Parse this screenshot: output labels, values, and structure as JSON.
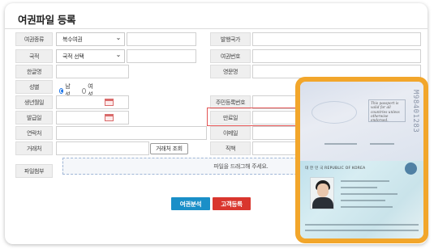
{
  "title": "여권파일 등록",
  "form": {
    "passport_type_label": "여권종류",
    "passport_type_value": "복수여권",
    "issuing_country_label": "발행국가",
    "nationality_label": "국적",
    "nationality_value": "국적 선택",
    "passport_no_label": "여권번호",
    "korean_name_label": "한글명",
    "english_name_label": "영문명",
    "gender_label": "성별",
    "gender_options": [
      "남성",
      "여성"
    ],
    "gender_selected": "남성",
    "birth_label": "생년월일",
    "resident_no_label": "주민등록번호",
    "issue_date_label": "발급일",
    "expiry_label": "만료일",
    "contact_label": "연락처",
    "email_label": "이메일",
    "client_label": "거래처",
    "client_search_label": "거래처 조회",
    "position_label": "직책",
    "file_attach_label": "파일첨부",
    "dropzone_text": "파일을 드래그해 주세요."
  },
  "buttons": {
    "analyze": "여권분석",
    "register": "고객등록"
  },
  "passport_image": {
    "serial": "M98401283",
    "header": "대 한 민 국   REPUBLIC OF KOREA",
    "stamp_text": "This passport is valid for all countries unless otherwise endorsed.",
    "frame_color": "#f2a62b"
  },
  "colors": {
    "analyze_button": "#1a8fc8",
    "register_button": "#d9362e",
    "highlight": "#e35454"
  }
}
